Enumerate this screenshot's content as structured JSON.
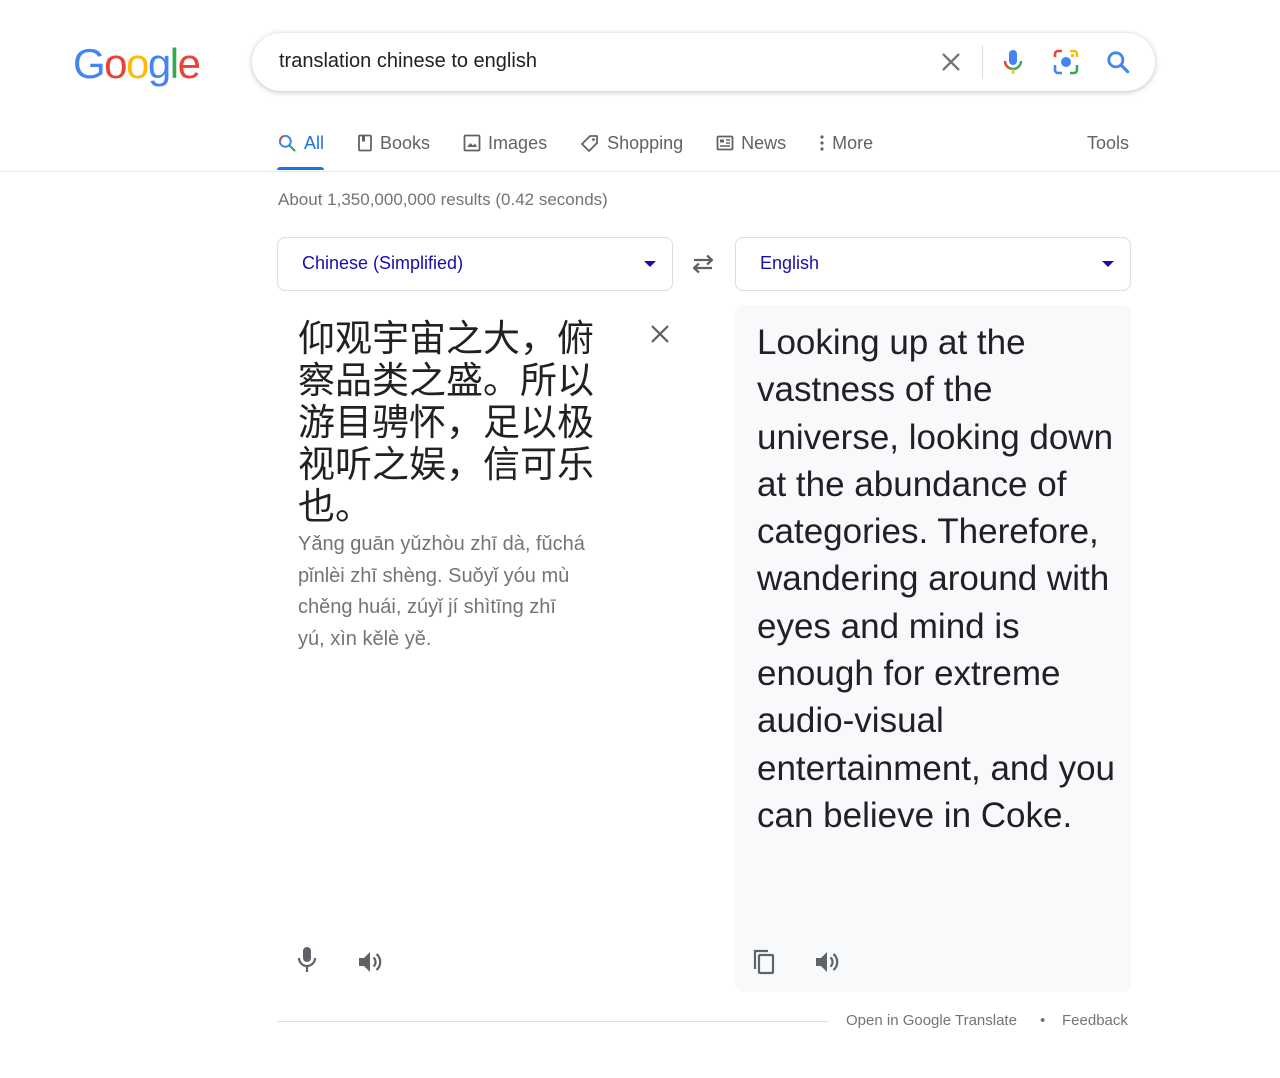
{
  "logo": {
    "letters": [
      "G",
      "o",
      "o",
      "g",
      "l",
      "e"
    ],
    "colors": [
      "#4285f4",
      "#ea4335",
      "#fbbc05",
      "#4285f4",
      "#34a853",
      "#ea4335"
    ]
  },
  "search": {
    "query": "translation chinese to english"
  },
  "search_icons": [
    "close-icon",
    "microphone-icon",
    "camera-lens-icon",
    "search-icon"
  ],
  "tabs": [
    {
      "label": "All",
      "icon": "search-icon",
      "active": true
    },
    {
      "label": "Books",
      "icon": "book-icon"
    },
    {
      "label": "Images",
      "icon": "image-icon"
    },
    {
      "label": "Shopping",
      "icon": "tag-icon"
    },
    {
      "label": "News",
      "icon": "newspaper-icon"
    },
    {
      "label": "More",
      "icon": "kebab-icon"
    }
  ],
  "tools_label": "Tools",
  "result_stats": "About 1,350,000,000 results (0.42 seconds)",
  "translator": {
    "source_lang": "Chinese (Simplified)",
    "target_lang": "English",
    "source_text": "仰观宇宙之大，俯察品类之盛。所以游目骋怀，足以极视听之娱，信可乐也。",
    "romanization": "Yǎng guān yǔzhòu zhī dà, fǔchá pǐnlèi zhī shèng. Suǒyǐ yóu mù chěng huái, zúyǐ jí shìtīng zhī yú, xìn kělè yě.",
    "target_text": "Looking up at the vastness of the universe, looking down at the abundance of categories. Therefore, wandering around with eyes and mind is enough for extreme audio-visual entertainment, and you can believe in Coke."
  },
  "footer": {
    "open_link": "Open in Google Translate",
    "separator": "•",
    "feedback": "Feedback"
  },
  "colors": {
    "accent": "#1a73e8",
    "link": "#1a0dab",
    "muted": "#70757a"
  }
}
